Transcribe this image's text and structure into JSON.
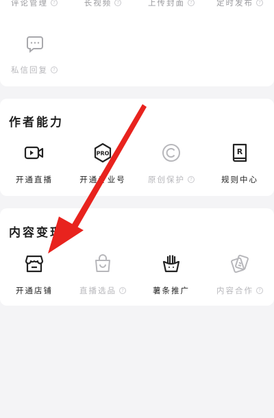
{
  "top_section": {
    "row1": [
      {
        "label": "评论管理",
        "icon": "comment-icon"
      },
      {
        "label": "长视频",
        "icon": "video-icon"
      },
      {
        "label": "上传封面",
        "icon": "cover-icon"
      },
      {
        "label": "定时发布",
        "icon": "clock-icon"
      }
    ],
    "row2": [
      {
        "label": "私信回复",
        "icon": "message-icon"
      }
    ]
  },
  "author_section": {
    "title": "作者能力",
    "items": [
      {
        "label": "开通直播",
        "icon": "live-icon",
        "enabled": true
      },
      {
        "label": "开通专业号",
        "icon": "pro-badge-icon",
        "enabled": true
      },
      {
        "label": "原创保护",
        "icon": "copyright-icon",
        "enabled": false
      },
      {
        "label": "规则中心",
        "icon": "rules-book-icon",
        "enabled": true
      }
    ]
  },
  "monetize_section": {
    "title": "内容变现",
    "items": [
      {
        "label": "开通店铺",
        "icon": "shop-icon",
        "enabled": true
      },
      {
        "label": "直播选品",
        "icon": "shopping-bag-icon",
        "enabled": false
      },
      {
        "label": "薯条推广",
        "icon": "fries-icon",
        "enabled": true
      },
      {
        "label": "内容合作",
        "icon": "cooperation-icon",
        "enabled": false
      }
    ]
  },
  "colors": {
    "background": "#f4f4f6",
    "card": "#ffffff",
    "text": "#222222",
    "disabled": "#b7b7bb",
    "arrow": "#e8231e"
  }
}
